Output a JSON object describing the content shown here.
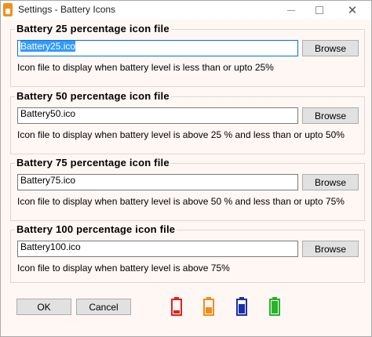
{
  "window": {
    "title": "Settings - Battery Icons"
  },
  "groups": [
    {
      "label": "Battery 25 percentage icon file",
      "value": "Battery25.ico",
      "browse": "Browse",
      "desc": "Icon file to display when battery level is less than or upto 25%"
    },
    {
      "label": "Battery 50 percentage icon file",
      "value": "Battery50.ico",
      "browse": "Browse",
      "desc": "Icon file to display when battery level is above 25 % and less than or upto 50%"
    },
    {
      "label": "Battery 75 percentage icon file",
      "value": "Battery75.ico",
      "browse": "Browse",
      "desc": "Icon file to display when battery level is above 50 % and less than or upto 75%"
    },
    {
      "label": "Battery 100 percentage icon file",
      "value": "Battery100.ico",
      "browse": "Browse",
      "desc": "Icon file to display when battery level is above 75%"
    }
  ],
  "buttons": {
    "ok": "OK",
    "cancel": "Cancel"
  },
  "battery_icons": [
    {
      "name": "battery-25-icon",
      "color": "#e02020",
      "level": 0.25
    },
    {
      "name": "battery-50-icon",
      "color": "#f28c18",
      "level": 0.5
    },
    {
      "name": "battery-75-icon",
      "color": "#1a2fa8",
      "level": 0.75
    },
    {
      "name": "battery-100-icon",
      "color": "#28b428",
      "level": 1.0
    }
  ]
}
